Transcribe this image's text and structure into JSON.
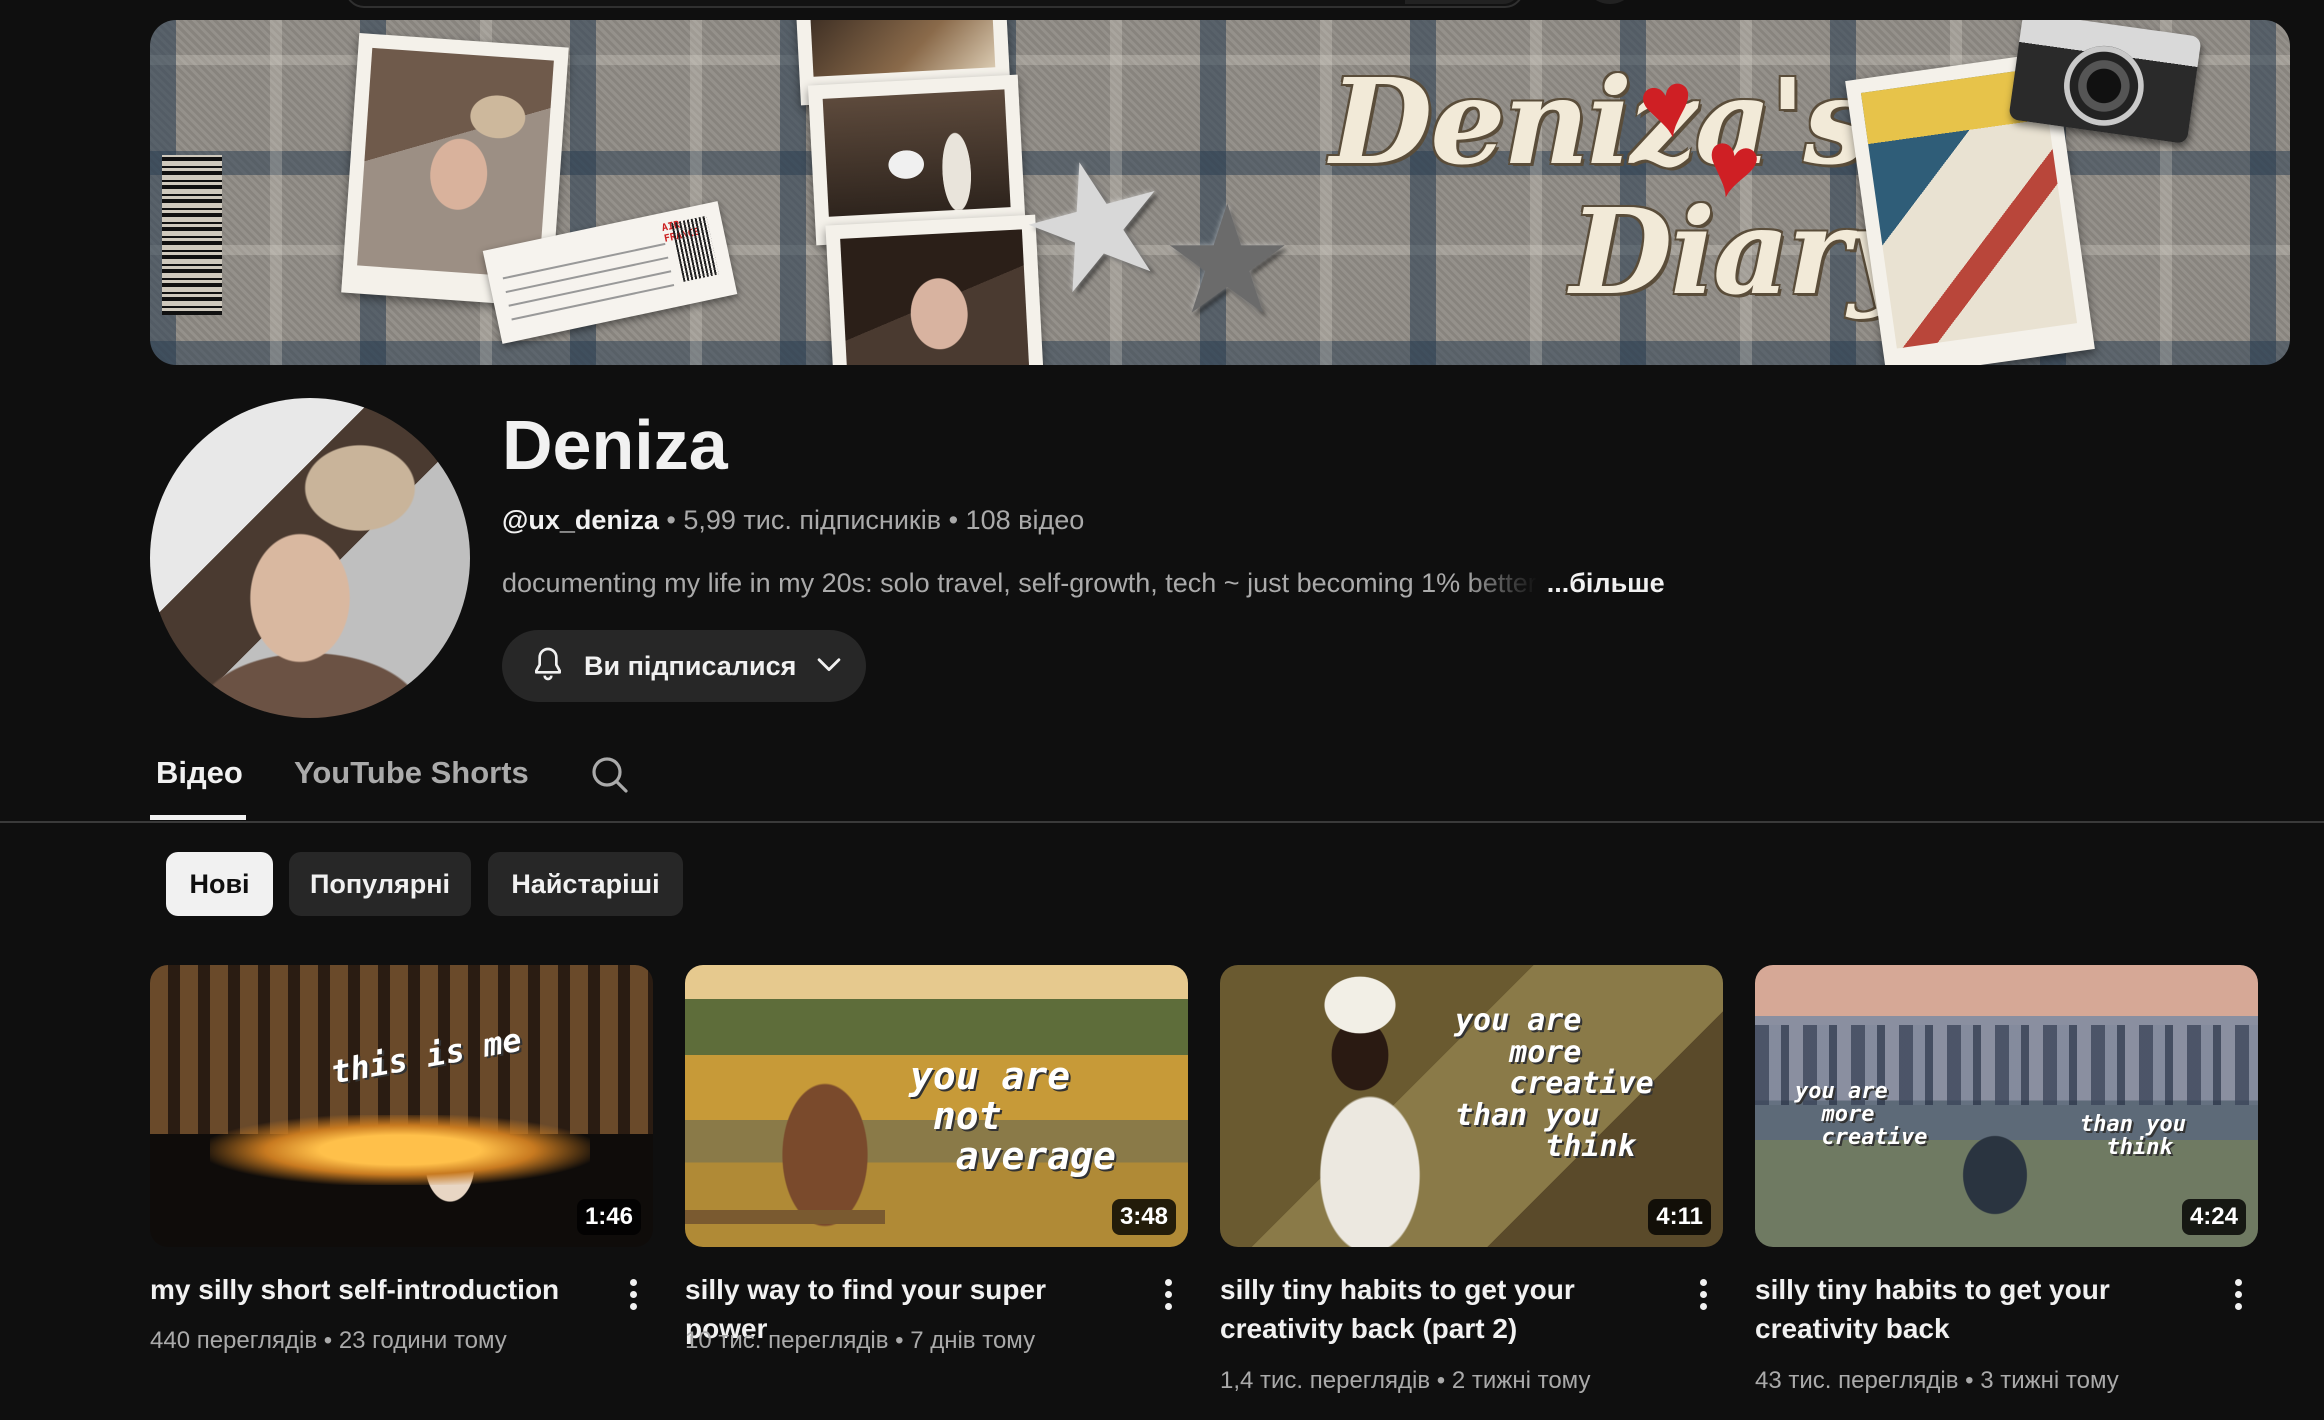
{
  "banner": {
    "title_line1": "Deniza's",
    "title_line2": "Diary",
    "ticket_label": "AIR FRANCE"
  },
  "channel": {
    "name": "Deniza",
    "handle": "@ux_deniza",
    "subscribers": "5,99 тис. підписників",
    "videos_count": "108 відео",
    "separator": " • ",
    "description": "documenting my life in my 20s: solo travel, self-growth, tech ~ just becoming 1% better",
    "more_label": "...більше",
    "subscribe_button": {
      "label": "Ви підписалися",
      "icon": "bell-icon",
      "dropdown_icon": "chevron-down-icon"
    }
  },
  "tabs": [
    {
      "label": "Відео",
      "active": true
    },
    {
      "label": "YouTube Shorts",
      "active": false
    }
  ],
  "tab_search_icon": "search-icon",
  "chips": [
    {
      "label": "Нові",
      "selected": true
    },
    {
      "label": "Популярні",
      "selected": false
    },
    {
      "label": "Найстаріші",
      "selected": false
    }
  ],
  "videos": [
    {
      "title": "my silly short self-introduction",
      "views": "440 переглядів",
      "age": "23 години тому",
      "duration": "1:46",
      "overlay": "this is me"
    },
    {
      "title": "silly way to find your super power",
      "views": "10 тис. переглядів",
      "age": "7 днів тому",
      "duration": "3:48",
      "overlay": "you are\n not\n  average"
    },
    {
      "title": "silly tiny habits to get your creativity back (part 2)",
      "views": "1,4 тис. переглядів",
      "age": "2 тижні тому",
      "duration": "4:11",
      "overlay": "you are\n   more\n   creative\nthan you\n     think"
    },
    {
      "title": "silly tiny habits to get your creativity back",
      "views": "43 тис. переглядів",
      "age": "3 тижні тому",
      "duration": "4:24",
      "overlay_left": "you are\n  more\n  creative",
      "overlay_right": "than you\n  think"
    }
  ],
  "colors": {
    "background": "#0f0f0f",
    "chip": "#272727",
    "chip_selected": "#f1f1f1",
    "text_primary": "#f1f1f1",
    "text_secondary": "#aaaaaa",
    "heart": "#cf1f24"
  }
}
